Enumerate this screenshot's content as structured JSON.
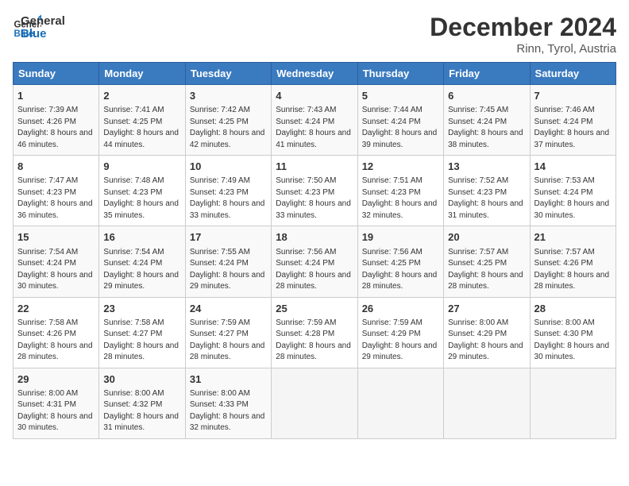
{
  "logo": {
    "line1": "General",
    "line2": "Blue"
  },
  "title": "December 2024",
  "subtitle": "Rinn, Tyrol, Austria",
  "days_of_week": [
    "Sunday",
    "Monday",
    "Tuesday",
    "Wednesday",
    "Thursday",
    "Friday",
    "Saturday"
  ],
  "weeks": [
    [
      {
        "day": "1",
        "sunrise": "7:39 AM",
        "sunset": "4:26 PM",
        "daylight": "8 hours and 46 minutes."
      },
      {
        "day": "2",
        "sunrise": "7:41 AM",
        "sunset": "4:25 PM",
        "daylight": "8 hours and 44 minutes."
      },
      {
        "day": "3",
        "sunrise": "7:42 AM",
        "sunset": "4:25 PM",
        "daylight": "8 hours and 42 minutes."
      },
      {
        "day": "4",
        "sunrise": "7:43 AM",
        "sunset": "4:24 PM",
        "daylight": "8 hours and 41 minutes."
      },
      {
        "day": "5",
        "sunrise": "7:44 AM",
        "sunset": "4:24 PM",
        "daylight": "8 hours and 39 minutes."
      },
      {
        "day": "6",
        "sunrise": "7:45 AM",
        "sunset": "4:24 PM",
        "daylight": "8 hours and 38 minutes."
      },
      {
        "day": "7",
        "sunrise": "7:46 AM",
        "sunset": "4:24 PM",
        "daylight": "8 hours and 37 minutes."
      }
    ],
    [
      {
        "day": "8",
        "sunrise": "7:47 AM",
        "sunset": "4:23 PM",
        "daylight": "8 hours and 36 minutes."
      },
      {
        "day": "9",
        "sunrise": "7:48 AM",
        "sunset": "4:23 PM",
        "daylight": "8 hours and 35 minutes."
      },
      {
        "day": "10",
        "sunrise": "7:49 AM",
        "sunset": "4:23 PM",
        "daylight": "8 hours and 33 minutes."
      },
      {
        "day": "11",
        "sunrise": "7:50 AM",
        "sunset": "4:23 PM",
        "daylight": "8 hours and 33 minutes."
      },
      {
        "day": "12",
        "sunrise": "7:51 AM",
        "sunset": "4:23 PM",
        "daylight": "8 hours and 32 minutes."
      },
      {
        "day": "13",
        "sunrise": "7:52 AM",
        "sunset": "4:23 PM",
        "daylight": "8 hours and 31 minutes."
      },
      {
        "day": "14",
        "sunrise": "7:53 AM",
        "sunset": "4:24 PM",
        "daylight": "8 hours and 30 minutes."
      }
    ],
    [
      {
        "day": "15",
        "sunrise": "7:54 AM",
        "sunset": "4:24 PM",
        "daylight": "8 hours and 30 minutes."
      },
      {
        "day": "16",
        "sunrise": "7:54 AM",
        "sunset": "4:24 PM",
        "daylight": "8 hours and 29 minutes."
      },
      {
        "day": "17",
        "sunrise": "7:55 AM",
        "sunset": "4:24 PM",
        "daylight": "8 hours and 29 minutes."
      },
      {
        "day": "18",
        "sunrise": "7:56 AM",
        "sunset": "4:24 PM",
        "daylight": "8 hours and 28 minutes."
      },
      {
        "day": "19",
        "sunrise": "7:56 AM",
        "sunset": "4:25 PM",
        "daylight": "8 hours and 28 minutes."
      },
      {
        "day": "20",
        "sunrise": "7:57 AM",
        "sunset": "4:25 PM",
        "daylight": "8 hours and 28 minutes."
      },
      {
        "day": "21",
        "sunrise": "7:57 AM",
        "sunset": "4:26 PM",
        "daylight": "8 hours and 28 minutes."
      }
    ],
    [
      {
        "day": "22",
        "sunrise": "7:58 AM",
        "sunset": "4:26 PM",
        "daylight": "8 hours and 28 minutes."
      },
      {
        "day": "23",
        "sunrise": "7:58 AM",
        "sunset": "4:27 PM",
        "daylight": "8 hours and 28 minutes."
      },
      {
        "day": "24",
        "sunrise": "7:59 AM",
        "sunset": "4:27 PM",
        "daylight": "8 hours and 28 minutes."
      },
      {
        "day": "25",
        "sunrise": "7:59 AM",
        "sunset": "4:28 PM",
        "daylight": "8 hours and 28 minutes."
      },
      {
        "day": "26",
        "sunrise": "7:59 AM",
        "sunset": "4:29 PM",
        "daylight": "8 hours and 29 minutes."
      },
      {
        "day": "27",
        "sunrise": "8:00 AM",
        "sunset": "4:29 PM",
        "daylight": "8 hours and 29 minutes."
      },
      {
        "day": "28",
        "sunrise": "8:00 AM",
        "sunset": "4:30 PM",
        "daylight": "8 hours and 30 minutes."
      }
    ],
    [
      {
        "day": "29",
        "sunrise": "8:00 AM",
        "sunset": "4:31 PM",
        "daylight": "8 hours and 30 minutes."
      },
      {
        "day": "30",
        "sunrise": "8:00 AM",
        "sunset": "4:32 PM",
        "daylight": "8 hours and 31 minutes."
      },
      {
        "day": "31",
        "sunrise": "8:00 AM",
        "sunset": "4:33 PM",
        "daylight": "8 hours and 32 minutes."
      },
      null,
      null,
      null,
      null
    ]
  ],
  "labels": {
    "sunrise": "Sunrise:",
    "sunset": "Sunset:",
    "daylight": "Daylight:"
  }
}
